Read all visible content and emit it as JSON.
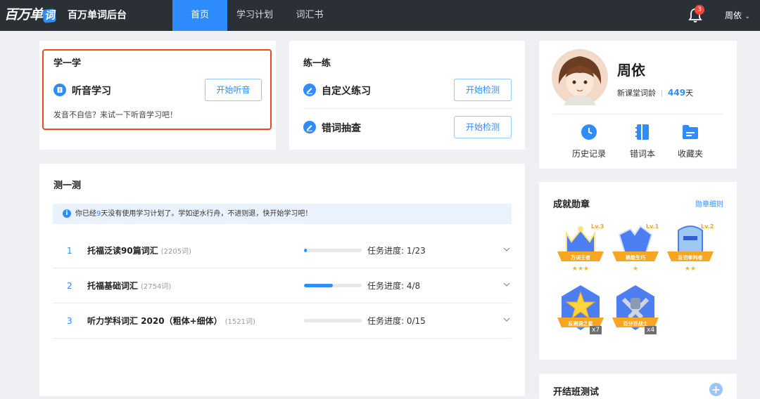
{
  "app": {
    "logo_text": "百万单",
    "logo_badge": "词",
    "title": "百万单词后台"
  },
  "nav": {
    "tabs": [
      {
        "label": "首页",
        "active": true
      },
      {
        "label": "学习计划",
        "active": false
      },
      {
        "label": "词汇书",
        "active": false
      }
    ],
    "notification_count": "3",
    "user_name": "周依"
  },
  "learn": {
    "title": "学一学",
    "item_label": "听音学习",
    "button": "开始听音",
    "desc": "发音不自信？来试一下听音学习吧！"
  },
  "practice": {
    "title": "练一练",
    "items": [
      {
        "label": "自定义练习",
        "button": "开始检测"
      },
      {
        "label": "错词抽查",
        "button": "开始检测"
      }
    ]
  },
  "test": {
    "title": "测一测",
    "notice_prefix": "你已经",
    "notice_num": "9",
    "notice_suffix": "天没有使用学习计划了。学如逆水行舟，不进则退，快开始学习吧！",
    "plans": [
      {
        "index": "1",
        "name": "托福泛读90篇词汇",
        "count": "(2205词)",
        "progress_text": "任务进度: 1/23",
        "progress": 0.043
      },
      {
        "index": "2",
        "name": "托福基础词汇",
        "count": "(2754词)",
        "progress_text": "任务进度: 4/8",
        "progress": 0.5
      },
      {
        "index": "3",
        "name": "听力学科词汇 2020（粗体+细体）",
        "count": "(1521词)",
        "progress_text": "任务进度: 0/15",
        "progress": 0
      }
    ]
  },
  "profile": {
    "name": "周依",
    "age_label": "新课堂词龄",
    "age_value": "449",
    "age_unit": "天",
    "quick_links": [
      {
        "label": "历史记录",
        "icon": "clock-icon"
      },
      {
        "label": "错词本",
        "icon": "notebook-icon"
      },
      {
        "label": "收藏夹",
        "icon": "folder-icon"
      }
    ]
  },
  "achievements": {
    "title": "成就勋章",
    "link": "勋章细则",
    "medals": [
      {
        "name": "万词王者",
        "level": "Lv.3",
        "stars": 3
      },
      {
        "name": "熟能生巧",
        "level": "Lv.1",
        "stars": 1
      },
      {
        "name": "反罚审判者",
        "level": "Lv.2",
        "stars": 2
      },
      {
        "name": "反刷词之星",
        "count": "x7"
      },
      {
        "name": "百分百战士",
        "count": "x4"
      }
    ]
  },
  "class_test": {
    "title": "开结班测试"
  },
  "colors": {
    "accent": "#2f8cff",
    "nav_bg": "#2b2f36",
    "highlight": "#f0471f",
    "page_bg": "#eef0f3"
  }
}
